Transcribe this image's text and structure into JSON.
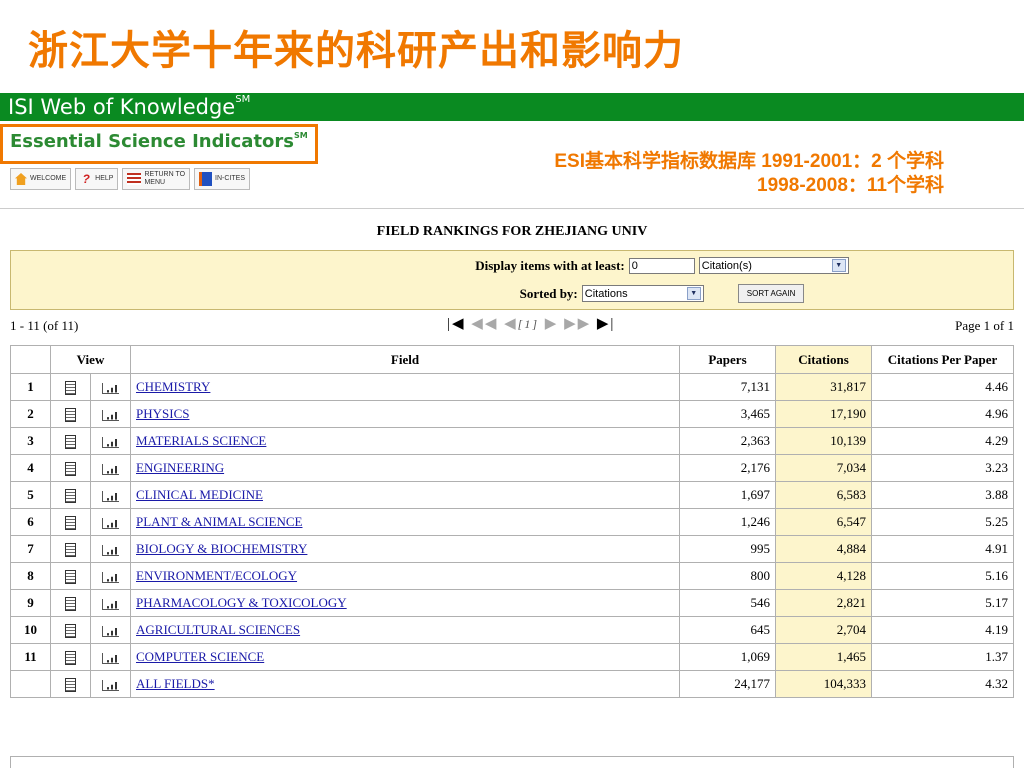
{
  "slide_title": "浙江大学十年来的科研产出和影响力",
  "header": {
    "isi_title": "ISI Web of Knowledge",
    "isi_mark": "SM",
    "esi_title": "Essential Science Indicators",
    "esi_mark": "SM"
  },
  "toolbar": {
    "welcome": "WELCOME",
    "help": "HELP",
    "return_line1": "RETURN TO",
    "return_line2": "MENU",
    "incites": "IN-CITES"
  },
  "notes": {
    "line1": "ESI基本科学指标数据库 1991-2001：2  个学科",
    "line2": "1998-2008：11个学科"
  },
  "page_title": "FIELD RANKINGS FOR ZHEJIANG UNIV",
  "filters": {
    "display_label": "Display items with at least:",
    "threshold_value": "0",
    "unit_select": "Citation(s)",
    "sorted_label": "Sorted by:",
    "sort_select": "Citations",
    "sort_button": "SORT AGAIN"
  },
  "pager": {
    "range": "1 - 11 (of 11)",
    "current": "1",
    "page_info": "Page 1 of 1"
  },
  "table": {
    "headers": {
      "view": "View",
      "field": "Field",
      "papers": "Papers",
      "citations": "Citations",
      "cpp": "Citations Per Paper"
    },
    "rows": [
      {
        "rank": "1",
        "field": "CHEMISTRY",
        "papers": "7,131",
        "citations": "31,817",
        "cpp": "4.46"
      },
      {
        "rank": "2",
        "field": "PHYSICS",
        "papers": "3,465",
        "citations": "17,190",
        "cpp": "4.96"
      },
      {
        "rank": "3",
        "field": "MATERIALS SCIENCE",
        "papers": "2,363",
        "citations": "10,139",
        "cpp": "4.29"
      },
      {
        "rank": "4",
        "field": "ENGINEERING",
        "papers": "2,176",
        "citations": "7,034",
        "cpp": "3.23"
      },
      {
        "rank": "5",
        "field": "CLINICAL MEDICINE",
        "papers": "1,697",
        "citations": "6,583",
        "cpp": "3.88"
      },
      {
        "rank": "6",
        "field": "PLANT & ANIMAL SCIENCE",
        "papers": "1,246",
        "citations": "6,547",
        "cpp": "5.25"
      },
      {
        "rank": "7",
        "field": "BIOLOGY & BIOCHEMISTRY",
        "papers": "995",
        "citations": "4,884",
        "cpp": "4.91"
      },
      {
        "rank": "8",
        "field": "ENVIRONMENT/ECOLOGY",
        "papers": "800",
        "citations": "4,128",
        "cpp": "5.16"
      },
      {
        "rank": "9",
        "field": "PHARMACOLOGY & TOXICOLOGY",
        "papers": "546",
        "citations": "2,821",
        "cpp": "5.17"
      },
      {
        "rank": "10",
        "field": "AGRICULTURAL SCIENCES",
        "papers": "645",
        "citations": "2,704",
        "cpp": "4.19"
      },
      {
        "rank": "11",
        "field": "COMPUTER SCIENCE",
        "papers": "1,069",
        "citations": "1,465",
        "cpp": "1.37"
      },
      {
        "rank": "",
        "field": "ALL FIELDS*",
        "papers": "24,177",
        "citations": "104,333",
        "cpp": "4.32"
      }
    ]
  },
  "colors": {
    "title_orange": "#f07800",
    "isi_green": "#0a8a21",
    "panel_yellow": "#fdf5cc",
    "link_blue": "#1a1aa8"
  },
  "icons": {
    "view_document": "document-icon",
    "view_chart": "bar-chart-icon"
  }
}
